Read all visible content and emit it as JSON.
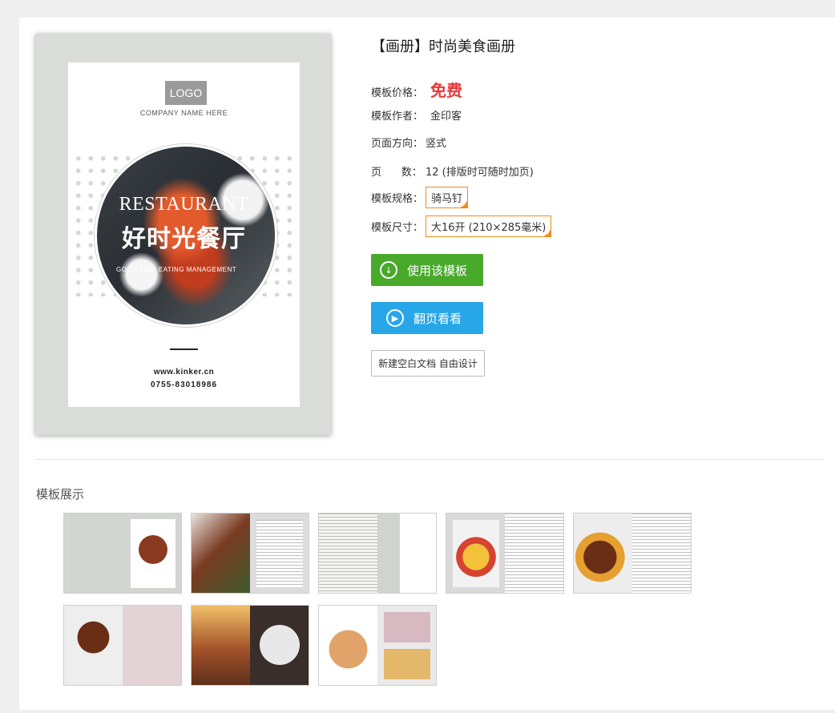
{
  "product": {
    "title": "【画册】时尚美食画册",
    "price_label": "模板价格：",
    "price_value": "免费",
    "author_label": "模板作者：",
    "author_value": "金印客",
    "orientation_label": "页面方向：",
    "orientation_value": "竖式",
    "pages_label": "页      数：",
    "pages_value": "12 (排版时可随时加页)",
    "spec_label": "模板规格：",
    "spec_value": "骑马钉",
    "size_label": "模板尺寸：",
    "size_value": "大16开 (210×285毫米)"
  },
  "cover": {
    "logo": "LOGO",
    "company": "COMPANY NAME HERE",
    "restaurant_title": "RESTAURANT",
    "cn_title": "好时光餐厅",
    "slogan": "GOOD TIME EATING MANAGEMENT",
    "url": "www.kinker.cn",
    "phone": "0755-83018986"
  },
  "actions": {
    "use_template": "使用该模板",
    "flip_view": "翻页看看",
    "new_blank": "新建空白文档 自由设计"
  },
  "gallery": {
    "section_title": "模板展示",
    "count": 8
  },
  "colors": {
    "price": "#e8393d",
    "use_button": "#49a92b",
    "flip_button": "#27a6e8",
    "tag_border": "#f08b1d"
  }
}
